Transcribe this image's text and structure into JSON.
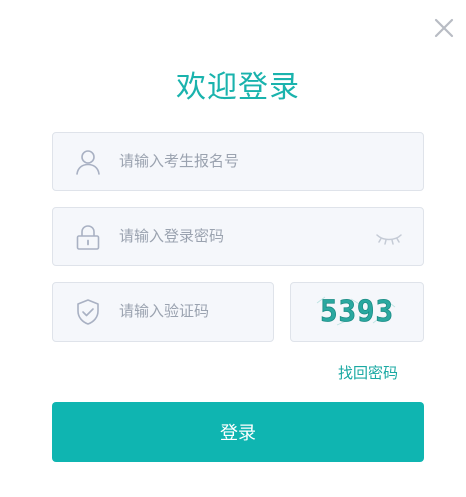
{
  "dialog": {
    "title": "欢迎登录",
    "close_icon": "close-icon"
  },
  "form": {
    "exam_number": {
      "placeholder": "请输入考生报名号",
      "icon": "user-icon"
    },
    "password": {
      "placeholder": "请输入登录密码",
      "icon": "lock-icon",
      "toggle_icon": "eye-closed-icon"
    },
    "captcha": {
      "placeholder": "请输入验证码",
      "icon": "shield-check-icon",
      "image_text": "5393"
    },
    "forgot_password": "找回密码",
    "submit_label": "登录"
  },
  "colors": {
    "accent": "#0fb5b1",
    "title": "#1ab3ad",
    "field_bg": "#f5f7fb",
    "field_border": "#dfe3ea",
    "placeholder": "#9ba3b0",
    "icon": "#a9b1c3"
  }
}
